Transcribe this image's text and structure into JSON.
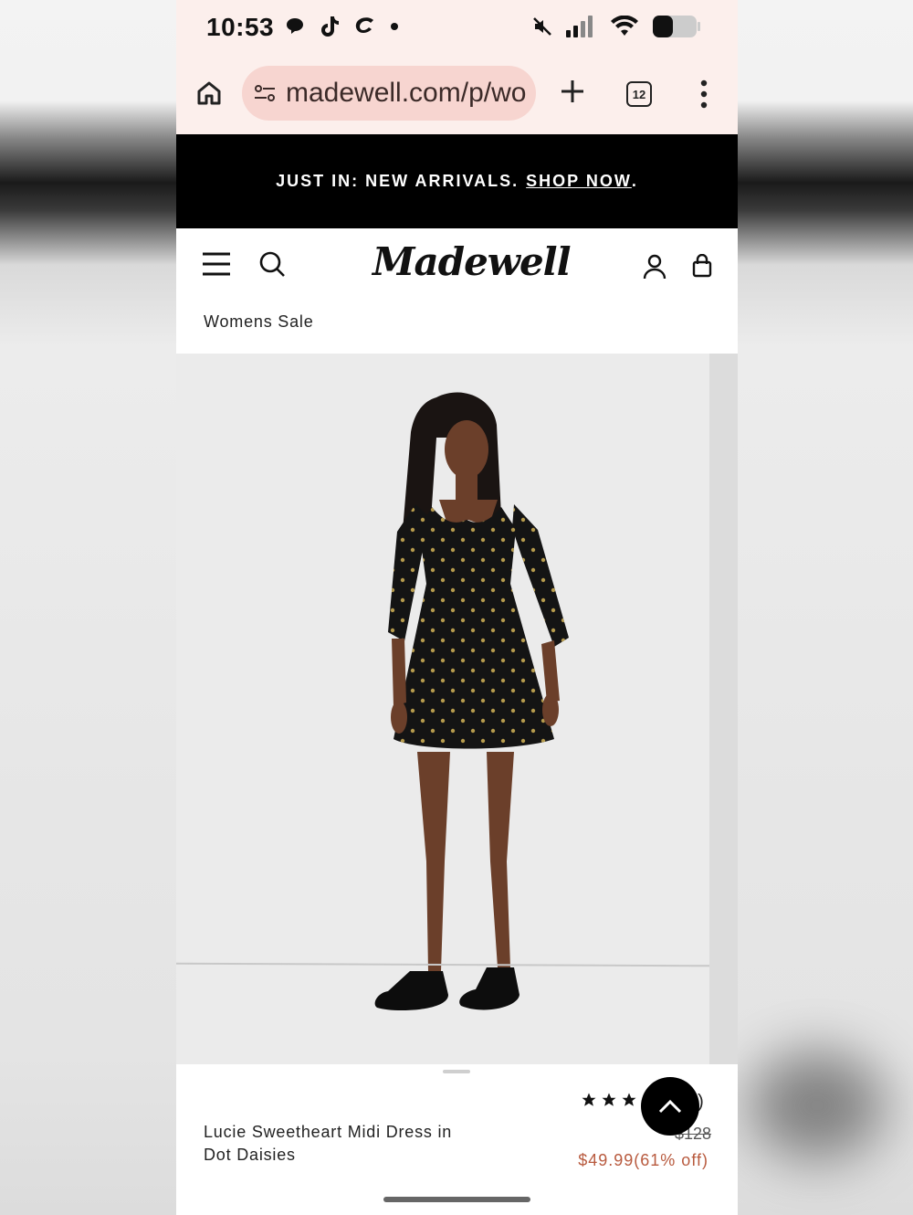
{
  "status_bar": {
    "time": "10:53",
    "left_icons": [
      "speech-bubble-icon",
      "tiktok-icon",
      "swoosh-app-icon",
      "dot-icon"
    ],
    "right_icons": [
      "muted-speaker-icon",
      "signal-icon",
      "wifi-icon",
      "battery-icon"
    ]
  },
  "browser": {
    "url": "madewell.com/p/wo",
    "tab_count": "12"
  },
  "promo": {
    "text": "JUST IN: NEW ARRIVALS.",
    "link": "SHOP NOW",
    "suffix": "."
  },
  "header": {
    "logo": "Madewell"
  },
  "breadcrumb": "Womens Sale",
  "product": {
    "title": "Lucie Sweetheart Midi Dress in Dot Daisies",
    "rating_count_visible": "5)",
    "original_price": "$128",
    "sale_price": "$49.99(61% off)"
  },
  "colors": {
    "chrome_bg": "#fcefec",
    "url_pill": "#f7d5d0",
    "promo_bg": "#000000",
    "sale_price": "#b85a3e"
  }
}
